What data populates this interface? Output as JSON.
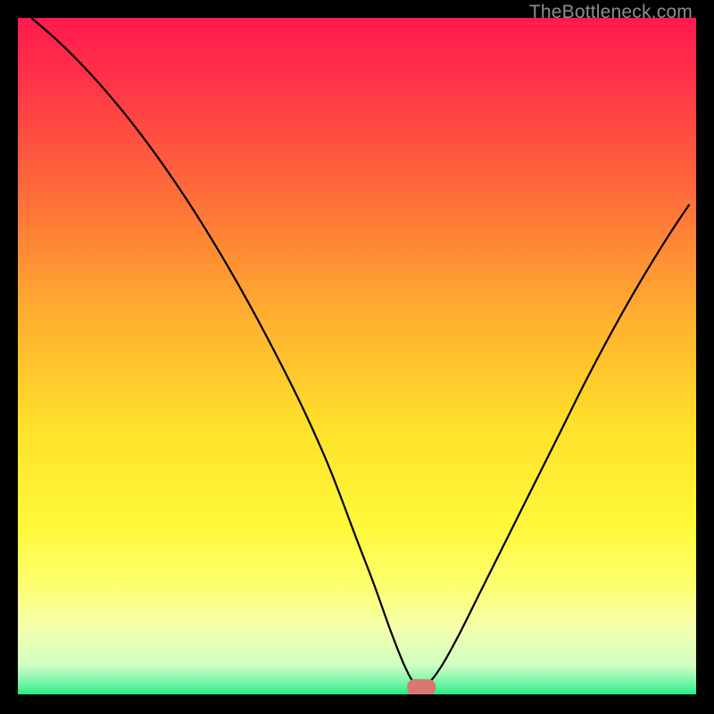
{
  "watermark": "TheBottleneck.com",
  "chart_data": {
    "type": "line",
    "title": "",
    "xlabel": "",
    "ylabel": "",
    "xlim": [
      0,
      100
    ],
    "ylim": [
      0,
      100
    ],
    "grid": false,
    "legend": false,
    "background_gradient": {
      "stops": [
        {
          "offset": 0.0,
          "color": "#ff1a4f"
        },
        {
          "offset": 0.1,
          "color": "#ff3547"
        },
        {
          "offset": 0.25,
          "color": "#ff6a3a"
        },
        {
          "offset": 0.45,
          "color": "#ffb22e"
        },
        {
          "offset": 0.6,
          "color": "#ffe02a"
        },
        {
          "offset": 0.75,
          "color": "#fff93a"
        },
        {
          "offset": 0.84,
          "color": "#fdff72"
        },
        {
          "offset": 0.9,
          "color": "#f3ffad"
        },
        {
          "offset": 0.955,
          "color": "#cfffc2"
        },
        {
          "offset": 0.985,
          "color": "#63f3a2"
        },
        {
          "offset": 1.0,
          "color": "#17e879"
        }
      ]
    },
    "series": [
      {
        "name": "bottleneck-curve",
        "color": "#000000",
        "x": [
          2,
          6,
          10,
          14,
          18,
          22,
          26,
          30,
          34,
          38,
          42,
          46,
          50,
          52.5,
          55,
          57,
          58.5,
          60.5,
          62.5,
          65,
          68,
          72,
          76,
          80,
          84,
          88,
          92,
          96,
          99
        ],
        "y": [
          100,
          96.5,
          92.5,
          88,
          83,
          77.5,
          71.5,
          65,
          58,
          50.5,
          42.5,
          33.5,
          23,
          16.5,
          9.5,
          4.5,
          2,
          2,
          4.5,
          9,
          15,
          23,
          31,
          39,
          47,
          54.5,
          61.5,
          68,
          72.5
        ]
      }
    ],
    "marker": {
      "name": "optimal-point",
      "x": 59.5,
      "y": 1.3,
      "width": 4.2,
      "height": 2.4,
      "color": "#d9786e"
    }
  }
}
